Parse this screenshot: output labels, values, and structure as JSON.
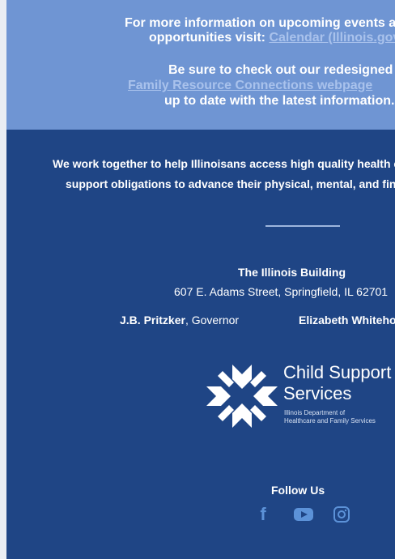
{
  "header": {
    "line1": "For more information on upcoming events and",
    "line2_prefix": "opportunities visit: ",
    "line2_link": "Calendar (Illinois.gov)",
    "line3": "Be sure to check out our redesigned",
    "line4_link": "Family Resource Connections webpage",
    "line5": "up to date with the latest information."
  },
  "footer": {
    "mission_line1": "We work together to help Illinoisans access high quality health care and fulfill child",
    "mission_line2": "support obligations to advance their physical, mental, and financial well-being.",
    "building_name": "The Illinois Building",
    "address": "607 E. Adams Street, Springfield, IL 62701",
    "governor_name": "J.B. Pritzker",
    "governor_title": ", Governor",
    "director_name": "Elizabeth Whitehorn",
    "logo": {
      "title_line1": "Child Support",
      "title_line2": "Services",
      "sub_line1": "Illinois Department of",
      "sub_line2": "Healthcare and Family Services"
    },
    "follow_label": "Follow Us",
    "social": {
      "facebook_glyph": "f",
      "facebook_icon": "facebook-icon",
      "youtube_icon": "youtube-icon",
      "instagram_icon": "instagram-icon"
    }
  },
  "colors": {
    "top_band": "#6f95d3",
    "footer_bg": "#1f4585",
    "link": "#a9c2ec",
    "social_icon": "#5c92d8"
  }
}
